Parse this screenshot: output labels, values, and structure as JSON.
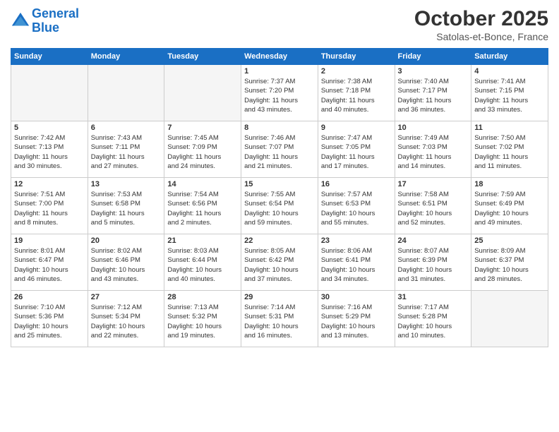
{
  "header": {
    "logo_line1": "General",
    "logo_line2": "Blue",
    "month_title": "October 2025",
    "location": "Satolas-et-Bonce, France"
  },
  "weekdays": [
    "Sunday",
    "Monday",
    "Tuesday",
    "Wednesday",
    "Thursday",
    "Friday",
    "Saturday"
  ],
  "weeks": [
    [
      {
        "day": "",
        "info": ""
      },
      {
        "day": "",
        "info": ""
      },
      {
        "day": "",
        "info": ""
      },
      {
        "day": "1",
        "info": "Sunrise: 7:37 AM\nSunset: 7:20 PM\nDaylight: 11 hours\nand 43 minutes."
      },
      {
        "day": "2",
        "info": "Sunrise: 7:38 AM\nSunset: 7:18 PM\nDaylight: 11 hours\nand 40 minutes."
      },
      {
        "day": "3",
        "info": "Sunrise: 7:40 AM\nSunset: 7:17 PM\nDaylight: 11 hours\nand 36 minutes."
      },
      {
        "day": "4",
        "info": "Sunrise: 7:41 AM\nSunset: 7:15 PM\nDaylight: 11 hours\nand 33 minutes."
      }
    ],
    [
      {
        "day": "5",
        "info": "Sunrise: 7:42 AM\nSunset: 7:13 PM\nDaylight: 11 hours\nand 30 minutes."
      },
      {
        "day": "6",
        "info": "Sunrise: 7:43 AM\nSunset: 7:11 PM\nDaylight: 11 hours\nand 27 minutes."
      },
      {
        "day": "7",
        "info": "Sunrise: 7:45 AM\nSunset: 7:09 PM\nDaylight: 11 hours\nand 24 minutes."
      },
      {
        "day": "8",
        "info": "Sunrise: 7:46 AM\nSunset: 7:07 PM\nDaylight: 11 hours\nand 21 minutes."
      },
      {
        "day": "9",
        "info": "Sunrise: 7:47 AM\nSunset: 7:05 PM\nDaylight: 11 hours\nand 17 minutes."
      },
      {
        "day": "10",
        "info": "Sunrise: 7:49 AM\nSunset: 7:03 PM\nDaylight: 11 hours\nand 14 minutes."
      },
      {
        "day": "11",
        "info": "Sunrise: 7:50 AM\nSunset: 7:02 PM\nDaylight: 11 hours\nand 11 minutes."
      }
    ],
    [
      {
        "day": "12",
        "info": "Sunrise: 7:51 AM\nSunset: 7:00 PM\nDaylight: 11 hours\nand 8 minutes."
      },
      {
        "day": "13",
        "info": "Sunrise: 7:53 AM\nSunset: 6:58 PM\nDaylight: 11 hours\nand 5 minutes."
      },
      {
        "day": "14",
        "info": "Sunrise: 7:54 AM\nSunset: 6:56 PM\nDaylight: 11 hours\nand 2 minutes."
      },
      {
        "day": "15",
        "info": "Sunrise: 7:55 AM\nSunset: 6:54 PM\nDaylight: 10 hours\nand 59 minutes."
      },
      {
        "day": "16",
        "info": "Sunrise: 7:57 AM\nSunset: 6:53 PM\nDaylight: 10 hours\nand 55 minutes."
      },
      {
        "day": "17",
        "info": "Sunrise: 7:58 AM\nSunset: 6:51 PM\nDaylight: 10 hours\nand 52 minutes."
      },
      {
        "day": "18",
        "info": "Sunrise: 7:59 AM\nSunset: 6:49 PM\nDaylight: 10 hours\nand 49 minutes."
      }
    ],
    [
      {
        "day": "19",
        "info": "Sunrise: 8:01 AM\nSunset: 6:47 PM\nDaylight: 10 hours\nand 46 minutes."
      },
      {
        "day": "20",
        "info": "Sunrise: 8:02 AM\nSunset: 6:46 PM\nDaylight: 10 hours\nand 43 minutes."
      },
      {
        "day": "21",
        "info": "Sunrise: 8:03 AM\nSunset: 6:44 PM\nDaylight: 10 hours\nand 40 minutes."
      },
      {
        "day": "22",
        "info": "Sunrise: 8:05 AM\nSunset: 6:42 PM\nDaylight: 10 hours\nand 37 minutes."
      },
      {
        "day": "23",
        "info": "Sunrise: 8:06 AM\nSunset: 6:41 PM\nDaylight: 10 hours\nand 34 minutes."
      },
      {
        "day": "24",
        "info": "Sunrise: 8:07 AM\nSunset: 6:39 PM\nDaylight: 10 hours\nand 31 minutes."
      },
      {
        "day": "25",
        "info": "Sunrise: 8:09 AM\nSunset: 6:37 PM\nDaylight: 10 hours\nand 28 minutes."
      }
    ],
    [
      {
        "day": "26",
        "info": "Sunrise: 7:10 AM\nSunset: 5:36 PM\nDaylight: 10 hours\nand 25 minutes."
      },
      {
        "day": "27",
        "info": "Sunrise: 7:12 AM\nSunset: 5:34 PM\nDaylight: 10 hours\nand 22 minutes."
      },
      {
        "day": "28",
        "info": "Sunrise: 7:13 AM\nSunset: 5:32 PM\nDaylight: 10 hours\nand 19 minutes."
      },
      {
        "day": "29",
        "info": "Sunrise: 7:14 AM\nSunset: 5:31 PM\nDaylight: 10 hours\nand 16 minutes."
      },
      {
        "day": "30",
        "info": "Sunrise: 7:16 AM\nSunset: 5:29 PM\nDaylight: 10 hours\nand 13 minutes."
      },
      {
        "day": "31",
        "info": "Sunrise: 7:17 AM\nSunset: 5:28 PM\nDaylight: 10 hours\nand 10 minutes."
      },
      {
        "day": "",
        "info": ""
      }
    ]
  ]
}
